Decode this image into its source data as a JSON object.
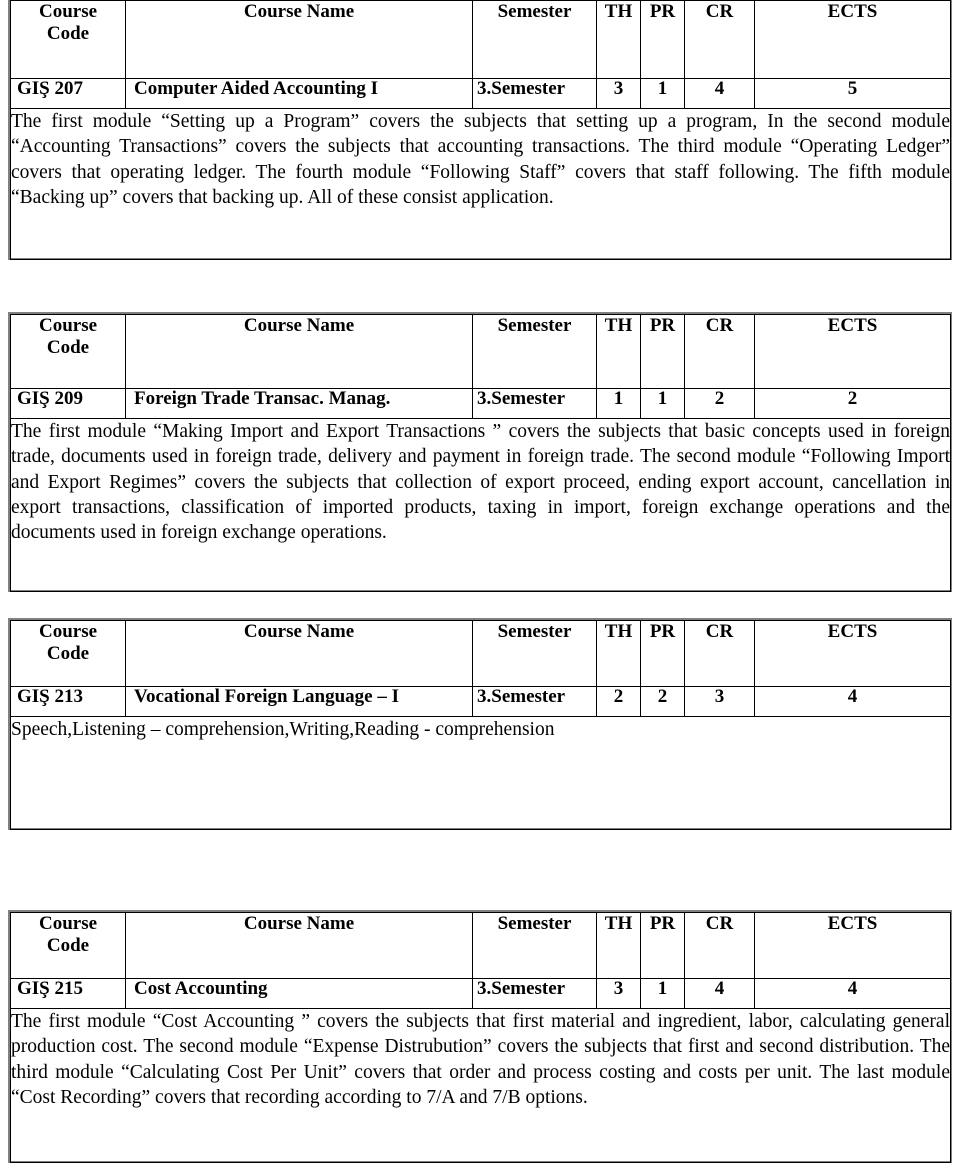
{
  "document": {
    "columns": [
      "Course Code",
      "Course Name",
      "Semester",
      "TH",
      "PR",
      "CR",
      "ECTS"
    ],
    "header": {
      "course_code_line1": "Course",
      "course_code_line2": "Code",
      "course_name": "Course Name",
      "semester": "Semester",
      "th": "TH",
      "pr": "PR",
      "cr": "CR",
      "ects": "ECTS"
    },
    "courses": [
      {
        "code": "GIŞ 207",
        "name": "Computer Aided Accounting I",
        "semester": "3.Semester",
        "th": "3",
        "pr": "1",
        "cr": "4",
        "ects": "5",
        "description": "The first module “Setting up a Program” covers the subjects that setting up a program, In the second module “Accounting Transactions” covers the subjects that accounting transactions. The third module “Operating Ledger” covers that operating ledger. The fourth module “Following Staff” covers that staff following. The fifth module “Backing up” covers that backing up. All of these consist application."
      },
      {
        "code": "GIŞ 209",
        "name": "Foreign Trade Transac. Manag.",
        "semester": "3.Semester",
        "th": "1",
        "pr": "1",
        "cr": "2",
        "ects": "2",
        "description": "The first module “Making Import and Export Transactions ” covers the subjects that basic concepts used in foreign trade, documents used in foreign trade, delivery and payment in  foreign trade. The second module “Following Import and Export Regimes” covers the subjects that collection of export proceed, ending export account, cancellation in export transactions, classification of imported products, taxing in import, foreign exchange operations and the documents used in foreign exchange operations."
      },
      {
        "code": "GIŞ 213",
        "name": "Vocational Foreign Language – I",
        "semester": "3.Semester",
        "th": "2",
        "pr": "2",
        "cr": "3",
        "ects": "4",
        "description": "Speech,Listening – comprehension,Writing,Reading - comprehension"
      },
      {
        "code": "GIŞ 215",
        "name": "Cost Accounting",
        "semester": "3.Semester",
        "th": "3",
        "pr": "1",
        "cr": "4",
        "ects": "4",
        "description": "The first module “Cost Accounting ” covers the subjects that first material and ingredient, labor, calculating general production cost. The second module “Expense Distrubution” covers the subjects that first and second distribution. The third module “Calculating Cost Per Unit” covers that order and process costing and costs per unit. The last module “Cost Recording” covers that recording according to 7/A and 7/B options."
      }
    ]
  }
}
